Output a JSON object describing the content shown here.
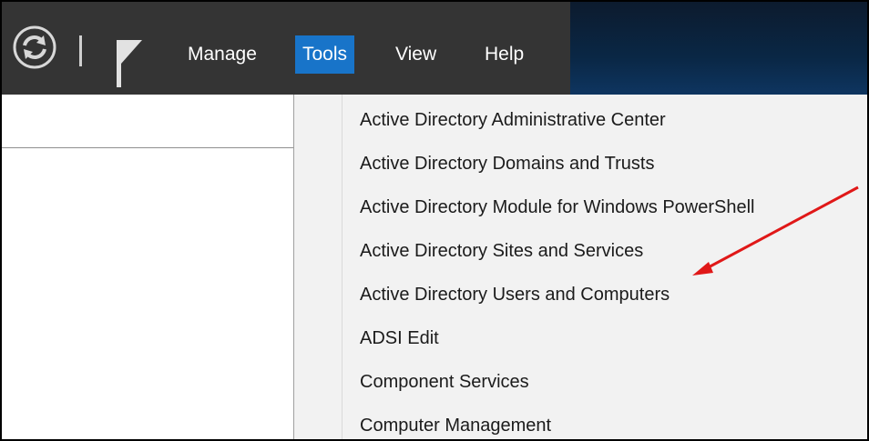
{
  "menubar": {
    "menus": [
      {
        "label": "Manage"
      },
      {
        "label": "Tools"
      },
      {
        "label": "View"
      },
      {
        "label": "Help"
      }
    ],
    "active_menu": "Tools",
    "icons": [
      "refresh-icon",
      "flag-icon"
    ]
  },
  "tools_menu": {
    "items": [
      {
        "label": "Active Directory Administrative Center"
      },
      {
        "label": "Active Directory Domains and Trusts"
      },
      {
        "label": "Active Directory Module for Windows PowerShell"
      },
      {
        "label": "Active Directory Sites and Services"
      },
      {
        "label": "Active Directory Users and Computers"
      },
      {
        "label": "ADSI Edit"
      },
      {
        "label": "Component Services"
      },
      {
        "label": "Computer Management"
      }
    ]
  },
  "annotation": {
    "arrow_color": "#e01818",
    "points_to": "Active Directory Users and Computers"
  },
  "colors": {
    "menubar_bg": "#343434",
    "active_menu_bg": "#1874c9",
    "dropdown_bg": "#f2f2f2"
  }
}
